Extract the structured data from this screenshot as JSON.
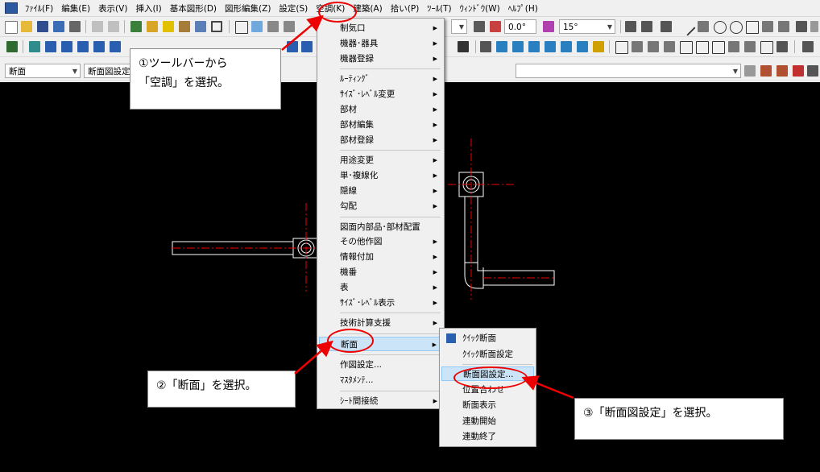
{
  "menubar": [
    "ﾌｧｲﾙ(F)",
    "編集(E)",
    "表示(V)",
    "挿入(I)",
    "基本図形(D)",
    "図形編集(Z)",
    "設定(S)",
    "空調(K)",
    "建築(A)",
    "拾い(P)",
    "ﾂｰﾙ(T)",
    "ｳｨﾝﾄﾞｳ(W)",
    "ﾍﾙﾌﾟ(H)"
  ],
  "toolbar": {
    "scale_value": "0.0°",
    "angle_value": "15°",
    "layer_combo": "断面",
    "view_combo": "断面図設定"
  },
  "aircon_menu": {
    "items": [
      {
        "label": "制気口",
        "sub": true
      },
      {
        "label": "機器･器具",
        "sub": true
      },
      {
        "label": "機器登録",
        "sub": true
      },
      {
        "label": "ﾙｰﾃｨﾝｸﾞ",
        "sub": true
      },
      {
        "label": "ｻｲｽﾞ･ﾚﾍﾞﾙ変更",
        "sub": true
      },
      {
        "label": "部材",
        "sub": true
      },
      {
        "label": "部材編集",
        "sub": true
      },
      {
        "label": "部材登録",
        "sub": true
      },
      {
        "label": "用途変更",
        "sub": true
      },
      {
        "label": "単･複線化",
        "sub": true
      },
      {
        "label": "隠線",
        "sub": true
      },
      {
        "label": "勾配",
        "sub": true
      },
      {
        "label": "図面内部品･部材配置",
        "sub": false
      },
      {
        "label": "その他作図",
        "sub": true
      },
      {
        "label": "情報付加",
        "sub": true
      },
      {
        "label": "機番",
        "sub": true
      },
      {
        "label": "表",
        "sub": true
      },
      {
        "label": "ｻｲｽﾞ･ﾚﾍﾞﾙ表示",
        "sub": true
      },
      {
        "label": "技術計算支援",
        "sub": true
      },
      {
        "label": "断面",
        "sub": true
      },
      {
        "label": "作図設定...",
        "sub": false
      },
      {
        "label": "ﾏｽﾀﾒﾝﾃ...",
        "sub": false
      },
      {
        "label": "ｼｰﾄ間接続",
        "sub": true
      }
    ]
  },
  "section_submenu": {
    "items": [
      "ｸｲｯｸ断面",
      "ｸｲｯｸ断面設定",
      "断面図設定...",
      "位置合わせ",
      "断面表示",
      "連動開始",
      "連動終了"
    ]
  },
  "callouts": {
    "step1_line1": "①ツールバーから",
    "step1_line2": "「空調」を選択。",
    "step2": "②「断面」を選択。",
    "step3": "③「断面図設定」を選択。"
  },
  "colors": {
    "accent_red": "#e00000",
    "highlight": "#cce4f7",
    "canvas": "#000000",
    "pipe": "#ffffff",
    "centerline": "#e00000"
  }
}
